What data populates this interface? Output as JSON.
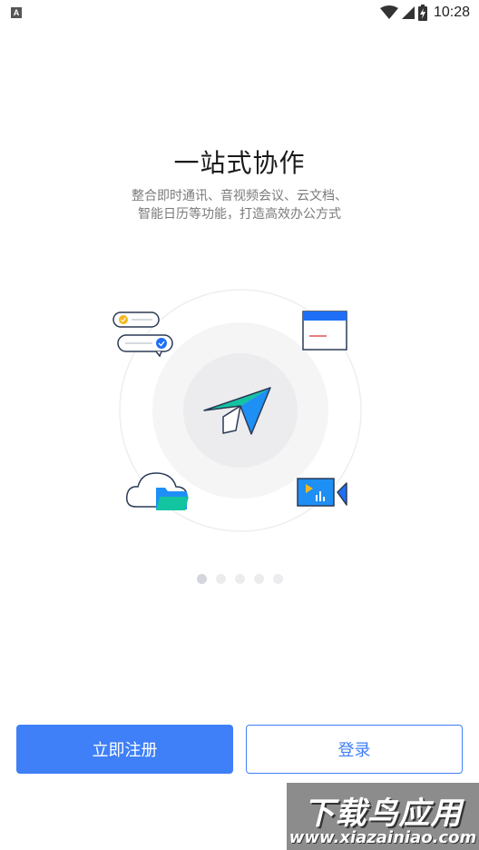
{
  "status_bar": {
    "notification_icon": "a-icon",
    "time": "10:28"
  },
  "onboarding": {
    "title": "一站式协作",
    "subtitle_line1": "整合即时通讯、音视频会议、云文档、",
    "subtitle_line2": "智能日历等功能，打造高效办公方式",
    "page_count": 5,
    "active_page": 1
  },
  "actions": {
    "register_label": "立即注册",
    "login_label": "登录"
  },
  "watermark": {
    "title": "下载鸟应用",
    "url": "www.xiazainiao.com"
  },
  "colors": {
    "accent": "#3f7ff7",
    "plane_teal": "#12c4a0",
    "plane_blue": "#1e8ff5"
  }
}
